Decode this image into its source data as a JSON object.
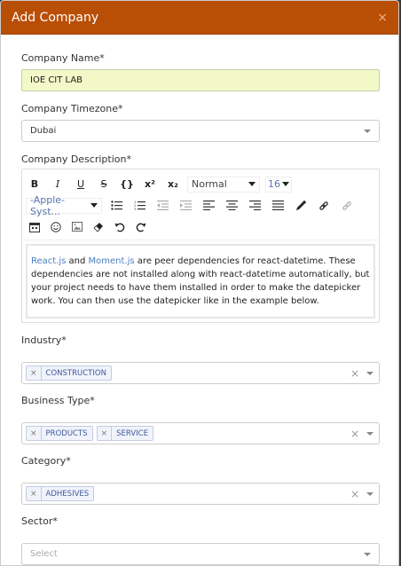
{
  "modal": {
    "title": "Add Company",
    "close": "×"
  },
  "fields": {
    "company_name": {
      "label": "Company Name*",
      "value": "IOE CIT LAB"
    },
    "timezone": {
      "label": "Company Timezone*",
      "value": "Dubai"
    },
    "description": {
      "label": "Company Description*",
      "toolbar": {
        "bold": "B",
        "italic": "I",
        "underline": "U",
        "strike": "S",
        "code": "{}",
        "superscript": "x²",
        "subscript": "x₂",
        "block_type": "Normal",
        "font_size": "16",
        "font_family": "-Apple-Syst..."
      },
      "content": {
        "link1": "React.js",
        "and": " and ",
        "link2": "Moment.js",
        "rest": " are peer dependencies for react-datetime. These dependencies are not installed along with react-datetime automatically, but your project needs to have them installed in order to make the datepicker work. You can then use the datepicker like in the example below."
      }
    },
    "industry": {
      "label": "Industry*",
      "tags": [
        "CONSTRUCTION"
      ]
    },
    "business_type": {
      "label": "Business Type*",
      "tags": [
        "PRODUCTS",
        "SERVICE"
      ]
    },
    "category": {
      "label": "Category*",
      "tags": [
        "ADHESIVES"
      ]
    },
    "sector": {
      "label": "Sector*",
      "placeholder": "Select"
    }
  },
  "icons": {
    "close": "×",
    "remove_tag": "×",
    "clear": "×"
  },
  "colors": {
    "header_bg": "#b94e05",
    "input_highlight": "#f2f8c7",
    "link": "#4a7fc1",
    "tag_text": "#3d5a99"
  }
}
